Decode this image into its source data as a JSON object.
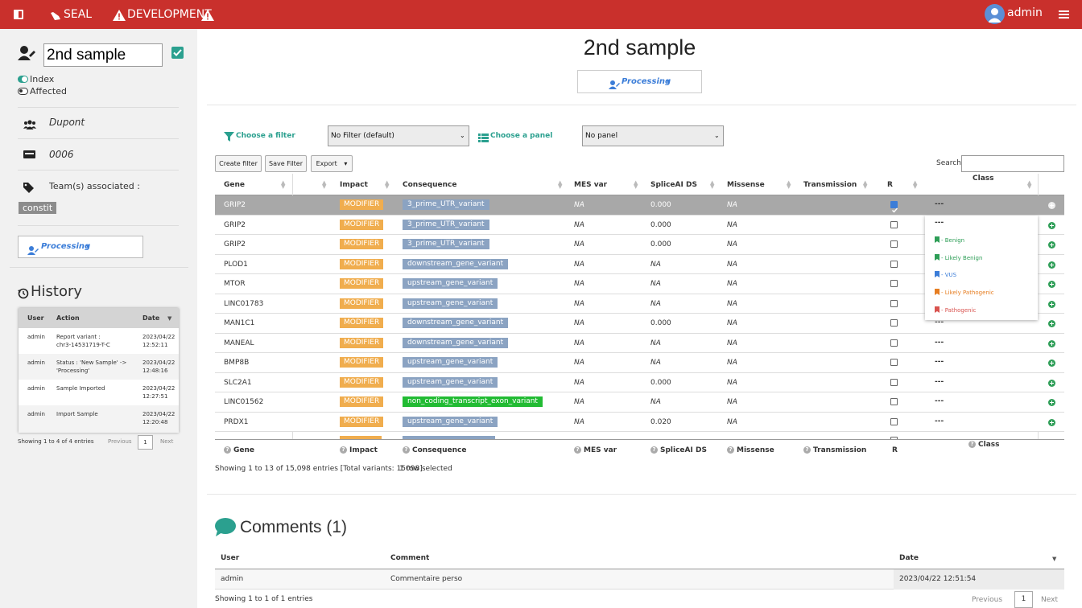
{
  "topbar": {
    "brand": "SEAL",
    "env": "DEVELOPMENT",
    "user": "admin"
  },
  "sample": {
    "name": "2nd sample",
    "index_label": "Index",
    "affected_label": "Affected",
    "family": "Dupont",
    "id": "0006",
    "teams_label": "Team(s) associated :",
    "team": "constit",
    "status": "Processing"
  },
  "history": {
    "title": "History",
    "columns": [
      "User",
      "Action",
      "Date"
    ],
    "rows": [
      {
        "user": "admin",
        "action1": "Report variant :",
        "action2": "chr3-14531719-T-C",
        "date1": "2023/04/22",
        "date2": "12:52:11"
      },
      {
        "user": "admin",
        "action1": "Status : 'New Sample' ->",
        "action2": "'Processing'",
        "date1": "2023/04/22",
        "date2": "12:48:16"
      },
      {
        "user": "admin",
        "action1": "Sample Imported",
        "action2": "",
        "date1": "2023/04/22",
        "date2": "12:27:51"
      },
      {
        "user": "admin",
        "action1": "Import Sample",
        "action2": "",
        "date1": "2023/04/22",
        "date2": "12:20:48"
      }
    ],
    "info": "Showing 1 to 4 of 4 entries",
    "prev": "Previous",
    "page": "1",
    "next": "Next"
  },
  "main": {
    "title": "2nd sample",
    "status": "Processing",
    "choose_filter": "Choose a filter",
    "filter_value": "No Filter (default)",
    "choose_panel": "Choose a panel",
    "panel_value": "No panel",
    "btn_create": "Create filter",
    "btn_save": "Save Filter",
    "btn_export": "Export",
    "search_label": "Search:",
    "search_value": "",
    "columns": [
      "Gene",
      "Impact",
      "Consequence",
      "MES var",
      "SpliceAI DS",
      "Missense",
      "Transmission",
      "R",
      "Class"
    ],
    "variants": [
      {
        "gene": "GRIP2",
        "impact": "MODIFIER",
        "cons": "3_prime_UTR_variant",
        "mes": "NA",
        "splice": "0.000",
        "missense": "NA"
      },
      {
        "gene": "GRIP2",
        "impact": "MODIFIER",
        "cons": "3_prime_UTR_variant",
        "mes": "NA",
        "splice": "0.000",
        "missense": "NA"
      },
      {
        "gene": "GRIP2",
        "impact": "MODIFIER",
        "cons": "3_prime_UTR_variant",
        "mes": "NA",
        "splice": "0.000",
        "missense": "NA"
      },
      {
        "gene": "PLOD1",
        "impact": "MODIFIER",
        "cons": "downstream_gene_variant",
        "mes": "NA",
        "splice": "NA",
        "missense": "NA"
      },
      {
        "gene": "MTOR",
        "impact": "MODIFIER",
        "cons": "upstream_gene_variant",
        "mes": "NA",
        "splice": "NA",
        "missense": "NA"
      },
      {
        "gene": "LINC01783",
        "impact": "MODIFIER",
        "cons": "upstream_gene_variant",
        "mes": "NA",
        "splice": "NA",
        "missense": "NA"
      },
      {
        "gene": "MAN1C1",
        "impact": "MODIFIER",
        "cons": "downstream_gene_variant",
        "mes": "NA",
        "splice": "0.000",
        "missense": "NA"
      },
      {
        "gene": "MANEAL",
        "impact": "MODIFIER",
        "cons": "downstream_gene_variant",
        "mes": "NA",
        "splice": "NA",
        "missense": "NA"
      },
      {
        "gene": "BMP8B",
        "impact": "MODIFIER",
        "cons": "upstream_gene_variant",
        "mes": "NA",
        "splice": "NA",
        "missense": "NA"
      },
      {
        "gene": "SLC2A1",
        "impact": "MODIFIER",
        "cons": "upstream_gene_variant",
        "mes": "NA",
        "splice": "0.000",
        "missense": "NA"
      },
      {
        "gene": "LINC01562",
        "impact": "MODIFIER",
        "cons": "non_coding_transcript_exon_variant",
        "mes": "NA",
        "splice": "NA",
        "missense": "NA"
      },
      {
        "gene": "PRDX1",
        "impact": "MODIFIER",
        "cons": "upstream_gene_variant",
        "mes": "NA",
        "splice": "0.020",
        "missense": "NA"
      }
    ],
    "class_dash": "---",
    "class_options": [
      {
        "label": "- Benign",
        "color": "#2e9e57"
      },
      {
        "label": "- Likely Benign",
        "color": "#2e9e57"
      },
      {
        "label": "- VUS",
        "color": "#3b7dd8"
      },
      {
        "label": "- Likely Pathogenic",
        "color": "#e67e22"
      },
      {
        "label": "- Pathogenic",
        "color": "#d9534f"
      }
    ],
    "table_info": "Showing 1 to 13 of 15,098 entries [Total variants: 15098]",
    "selected_info": "1 row selected"
  },
  "comments": {
    "title": "Comments (1)",
    "columns": [
      "User",
      "Comment",
      "Date"
    ],
    "row": {
      "user": "admin",
      "comment": "Commentaire perso",
      "date": "2023/04/22 12:51:54"
    },
    "info": "Showing 1 to 1 of 1 entries",
    "prev": "Previous",
    "page": "1",
    "next": "Next"
  }
}
